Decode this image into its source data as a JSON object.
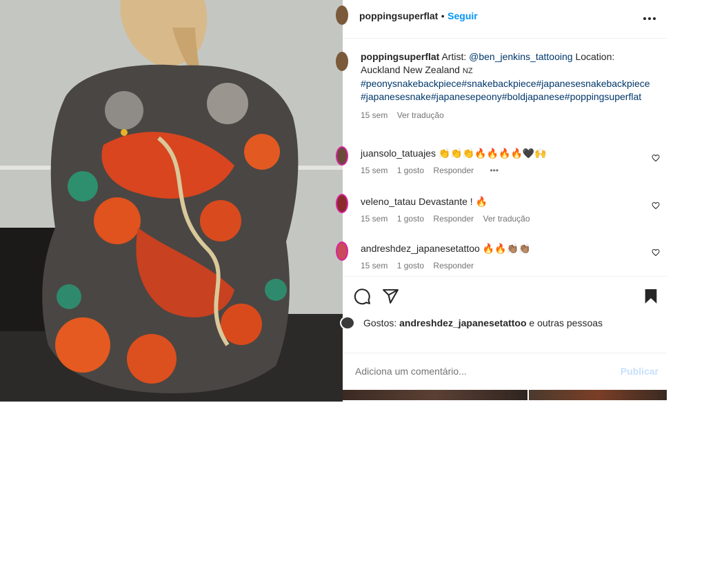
{
  "post": {
    "author": "poppingsuperflat",
    "follow_label": "Seguir",
    "separator": "•",
    "more_label": "•••"
  },
  "caption": {
    "username": "poppingsuperflat",
    "text_part1": " Artist: ",
    "mention": "@ben_jenkins_tattooing",
    "text_part2": " Location: Auckland New Zealand ",
    "region_flag": "NZ",
    "hashtags": "#peonysnakebackpiece#snakebackpiece#japanesesnakebackpiece#japanesesnake#japanesepeony#boldjapanese#poppingsuperflat",
    "time": "15 sem",
    "translate_label": "Ver tradução"
  },
  "comments": [
    {
      "username": "juansolo_tatuajes",
      "text": " 👏👏👏🔥🔥🔥🔥🖤🙌",
      "time": "15 sem",
      "likes": "1 gosto",
      "reply_label": "Responder",
      "extra": "•••"
    },
    {
      "username": "veleno_tatau",
      "text": " Devastante ! 🔥",
      "time": "15 sem",
      "likes": "1 gosto",
      "reply_label": "Responder",
      "extra": "Ver tradução"
    },
    {
      "username": "andreshdez_japanesetattoo",
      "text": " 🔥🔥👏🏽👏🏽",
      "time": "15 sem",
      "likes": "1 gosto",
      "reply_label": "Responder",
      "extra": ""
    }
  ],
  "likes": {
    "prefix": "Gostos: ",
    "user": "andreshdez_japanesetattoo",
    "suffix": " e outras pessoas"
  },
  "add_comment": {
    "placeholder": "Adiciona um comentário...",
    "publish_label": "Publicar"
  },
  "icons": {
    "comment": "comment-bubble-icon",
    "share": "paper-plane-icon",
    "save": "bookmark-filled-icon",
    "heart": "heart-outline-icon"
  },
  "colors": {
    "accent": "#0095f6",
    "hashtag": "#00376b",
    "muted": "#737373",
    "publish_disabled": "#c7e0fd"
  }
}
